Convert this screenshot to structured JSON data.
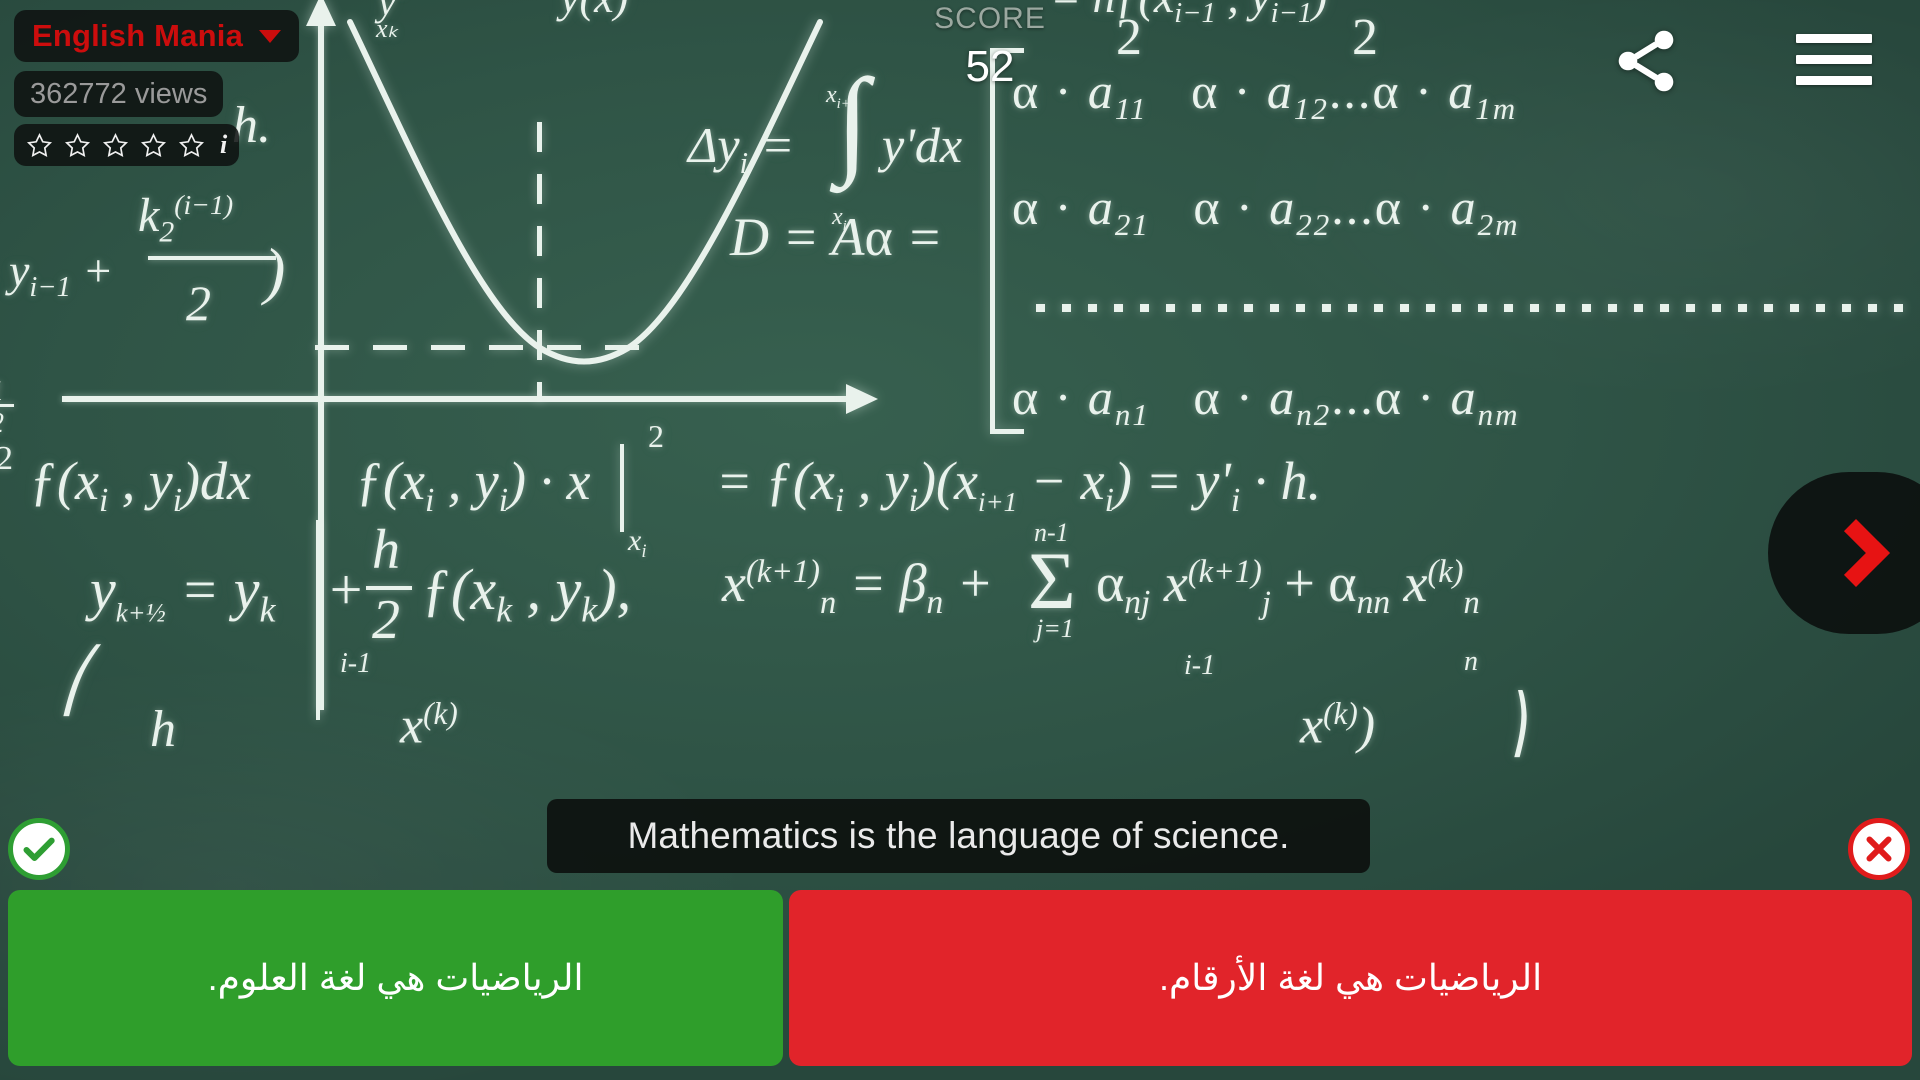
{
  "header": {
    "channel_name": "English Mania",
    "channel_dropdown_icon": "chevron-down-icon",
    "views_text": "362772 views",
    "rating_stars": 5,
    "rating_filled": 0,
    "info_glyph": "i",
    "share_icon": "share-icon",
    "menu_icon": "hamburger-menu-icon"
  },
  "score": {
    "label": "SCORE",
    "value": "52"
  },
  "navigation": {
    "next_icon": "chevron-right-icon"
  },
  "status": {
    "correct_icon": "check-circle-icon",
    "wrong_icon": "x-circle-icon"
  },
  "subtitle": {
    "text": "Mathematics is the language of science."
  },
  "answers": [
    {
      "label": "الرياضيات هي لغة العلوم.",
      "state": "correct",
      "color": "#2f9e2b"
    },
    {
      "label": "الرياضيات هي لغة الأرقام.",
      "state": "wrong",
      "color": "#e1242a"
    }
  ],
  "colors": {
    "board": "#2f5446",
    "brand_red": "#cc0d0d",
    "chalk": "#e9f2ec",
    "correct": "#2f9e2b",
    "wrong": "#e1242a",
    "accent_arrow": "#e71313"
  },
  "blackboard": {
    "formulas": [
      {
        "id": "f-top-partial",
        "text": "y'"
      },
      {
        "id": "f-xk",
        "text": "xₖ"
      },
      {
        "id": "f-k2",
        "text": "k₂"
      },
      {
        "id": "f-delta-y",
        "text": "Δyᵢ = ∫ y'dx"
      },
      {
        "id": "f-integral-top",
        "text": "xᵢ₊₁"
      },
      {
        "id": "f-integral-bot",
        "text": "xᵢ"
      },
      {
        "id": "f-D",
        "text": "D = Aα ="
      },
      {
        "id": "f-row1",
        "text": "α · a₁₁   α · a₁₂...α · a₁ₘ"
      },
      {
        "id": "f-row2",
        "text": "α · a₂₁   α · a₂₂...α · a₂ₘ"
      },
      {
        "id": "f-rown",
        "text": "α · aₙ₁   α · aₙ₂...α · aₙₘ"
      },
      {
        "id": "f-left-int",
        "text": "f(xᵢ , yᵢ)dx"
      },
      {
        "id": "f-mid-int",
        "text": "f(xᵢ , yᵢ) · x"
      },
      {
        "id": "f-rhs",
        "text": "= f(xᵢ , yᵢ)(xᵢ₊₁ − xᵢ) = y'ᵢ · h."
      },
      {
        "id": "f-euler",
        "text": "yₖ₊½ = yₖ + (h/2) f(xₖ , yₖ),"
      },
      {
        "id": "f-iter",
        "text": "x⁽ᵏ⁺¹⁾ₙ = βₙ + Σ αₙⱼ x⁽ᵏ⁺¹⁾ⱼ + αₙₙ x⁽ᵏ⁾ₙ"
      },
      {
        "id": "f-h-label",
        "text": "h."
      },
      {
        "id": "f-yi-left",
        "text": ", yᵢ₋₁ +"
      }
    ],
    "graph": {
      "curve": "parabola",
      "guide_lines": [
        "vertical-dashed",
        "horizontal-dashed"
      ],
      "axes": [
        "x-axis",
        "y-axis"
      ]
    }
  }
}
